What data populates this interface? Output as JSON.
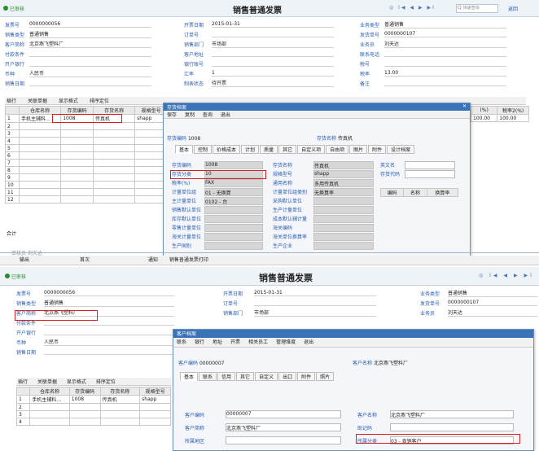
{
  "top": {
    "badge": "已审核",
    "title": "销售普通发票",
    "search_placeholder": "快速查询",
    "back_label": "返回",
    "header_fields": [
      {
        "label": "发票号",
        "value": "0000000056"
      },
      {
        "label": "销售类型",
        "value": "普通销售"
      },
      {
        "label": "客户简称",
        "value": "北京燕飞塑料厂"
      },
      {
        "label": "付款条件",
        "value": ""
      },
      {
        "label": "开户银行",
        "value": ""
      },
      {
        "label": "币种",
        "value": "人民币"
      },
      {
        "label": "销售日期",
        "value": ""
      }
    ],
    "mid_fields": [
      {
        "label": "开票日期",
        "value": "2015-01-31"
      },
      {
        "label": "订单号",
        "value": ""
      },
      {
        "label": "销售部门",
        "value": "市场部"
      },
      {
        "label": "客户地址",
        "value": ""
      },
      {
        "label": "银行账号",
        "value": ""
      },
      {
        "label": "汇率",
        "value": "1"
      },
      {
        "label": "制表状态",
        "value": "待开票"
      }
    ],
    "right_fields": [
      {
        "label": "业务类型",
        "value": "普通销售"
      },
      {
        "label": "发货单号",
        "value": "0000000107"
      },
      {
        "label": "业务员",
        "value": "刘天达"
      },
      {
        "label": "联系电话",
        "value": ""
      },
      {
        "label": "税号",
        "value": ""
      },
      {
        "label": "税率",
        "value": "13.00"
      },
      {
        "label": "备注",
        "value": ""
      }
    ],
    "grid_toolbar": [
      "插行",
      "关联单据",
      "显示格式",
      "排序定位"
    ],
    "grid_headers": [
      "",
      "仓库名称",
      "存货编码",
      "存货名称",
      "规格型号"
    ],
    "grid_rows": [
      {
        "no": "1",
        "warehouse": "手机主辅料…",
        "code": "1008",
        "name": "传真机",
        "spec": "shapp",
        "extra": "台"
      },
      {
        "no": "2"
      },
      {
        "no": "3"
      },
      {
        "no": "4"
      },
      {
        "no": "5"
      },
      {
        "no": "6"
      },
      {
        "no": "7"
      },
      {
        "no": "8"
      },
      {
        "no": "9"
      },
      {
        "no": "10"
      },
      {
        "no": "11"
      },
      {
        "no": "12"
      }
    ],
    "sum_label": "合计",
    "right_cols": [
      "(%)",
      "税率2(%)"
    ],
    "right_vals": [
      "100.00",
      "100.00"
    ],
    "footer_text": "审核员 刘天达"
  },
  "inv_dialog": {
    "title": "存货档案",
    "toolbar": [
      "保存",
      "复制",
      "查询",
      "退出"
    ],
    "code_label": "存货编码",
    "code_value": "1008",
    "name_label": "存货名称",
    "name_value": "传真机",
    "tabs": [
      "基本",
      "控制",
      "价格成本",
      "计划",
      "质量",
      "其它",
      "自定义项",
      "自由项",
      "图片",
      "附件",
      "设计档案"
    ],
    "left_fields": [
      {
        "label": "存货编码",
        "value": "1008"
      },
      {
        "label": "存货分类",
        "value": "10"
      },
      {
        "label": "税率(%)",
        "value": "FAX"
      },
      {
        "label": "计量单位组",
        "value": "01 - 无换算"
      },
      {
        "label": "主计量单位",
        "value": "0102 - 台"
      },
      {
        "label": "销售默认单位",
        "value": ""
      },
      {
        "label": "库存默认单位",
        "value": ""
      },
      {
        "label": "零售计量单位",
        "value": ""
      },
      {
        "label": "海关计量单位",
        "value": ""
      },
      {
        "label": "生产国别",
        "value": ""
      }
    ],
    "mid_fields": [
      {
        "label": "存货名称",
        "value": "传真机"
      },
      {
        "label": "规格型号",
        "value": "shapp"
      },
      {
        "label": "通用名称",
        "value": "多用传真机"
      },
      {
        "label": "计量单位组类别",
        "value": "无换算率"
      },
      {
        "label": "采购默认单位",
        "value": ""
      },
      {
        "label": "生产计量单位",
        "value": ""
      },
      {
        "label": "成本默认辅计量",
        "value": ""
      },
      {
        "label": "海关编码",
        "value": ""
      },
      {
        "label": "海关单位换算率",
        "value": ""
      },
      {
        "label": "生产企业",
        "value": ""
      }
    ],
    "right_fields": [
      {
        "label": "英文名",
        "value": ""
      },
      {
        "label": "存货代码",
        "value": ""
      }
    ],
    "subgrid_headers": [
      "编码",
      "名称",
      "换算率"
    ]
  },
  "bottom": {
    "toolbar": [
      "输出",
      "首次",
      "通知",
      "销售普通发票打印"
    ],
    "badge": "已审核",
    "title": "销售普通发票",
    "header_fields": [
      {
        "label": "发票号",
        "value": "0000000056"
      },
      {
        "label": "销售类型",
        "value": "普通销售"
      },
      {
        "label": "客户简称",
        "value": "北京燕飞塑料厂"
      },
      {
        "label": "付款条件",
        "value": ""
      },
      {
        "label": "开户银行",
        "value": ""
      },
      {
        "label": "币种",
        "value": "人民币"
      },
      {
        "label": "销售日期",
        "value": ""
      }
    ],
    "mid_fields": [
      {
        "label": "开票日期",
        "value": "2015-01-31"
      },
      {
        "label": "订单号",
        "value": ""
      },
      {
        "label": "销售部门",
        "value": "市场部"
      }
    ],
    "right_fields": [
      {
        "label": "业务类型",
        "value": "普通销售"
      },
      {
        "label": "发货单号",
        "value": "0000000107"
      },
      {
        "label": "业务员",
        "value": "刘天达"
      }
    ],
    "grid_toolbar": [
      "插行",
      "关联单据",
      "显示格式",
      "排序定位"
    ],
    "grid_headers": [
      "",
      "仓库名称",
      "存货编码",
      "存货名称",
      "规格型号"
    ],
    "grid_rows": [
      {
        "no": "1",
        "warehouse": "手机主辅料…",
        "code": "1008",
        "name": "传真机",
        "spec": "shapp"
      },
      {
        "no": "2"
      },
      {
        "no": "3"
      },
      {
        "no": "4"
      }
    ]
  },
  "cust_dialog": {
    "title": "客户档案",
    "toolbar": [
      "联系",
      "银行",
      "地址",
      "开票",
      "相关员工",
      "管理维度",
      "退出"
    ],
    "code_label": "客户编码",
    "code_value": "00000007",
    "name_label": "客户名称",
    "name_value": "北京燕飞塑料厂",
    "tabs": [
      "基本",
      "联系",
      "信用",
      "其它",
      "自定义",
      "出口",
      "附件",
      "照片"
    ],
    "fields_left": [
      {
        "label": "客户编码",
        "value": "00000007"
      },
      {
        "label": "客户简称",
        "value": "北京燕飞塑料厂"
      },
      {
        "label": "所属地区",
        "value": ""
      }
    ],
    "fields_right": [
      {
        "label": "客户名称",
        "value": "北京燕飞塑料厂"
      },
      {
        "label": "助记码",
        "value": ""
      },
      {
        "label": "所属分类",
        "value": "03 - 直销客户"
      }
    ]
  }
}
